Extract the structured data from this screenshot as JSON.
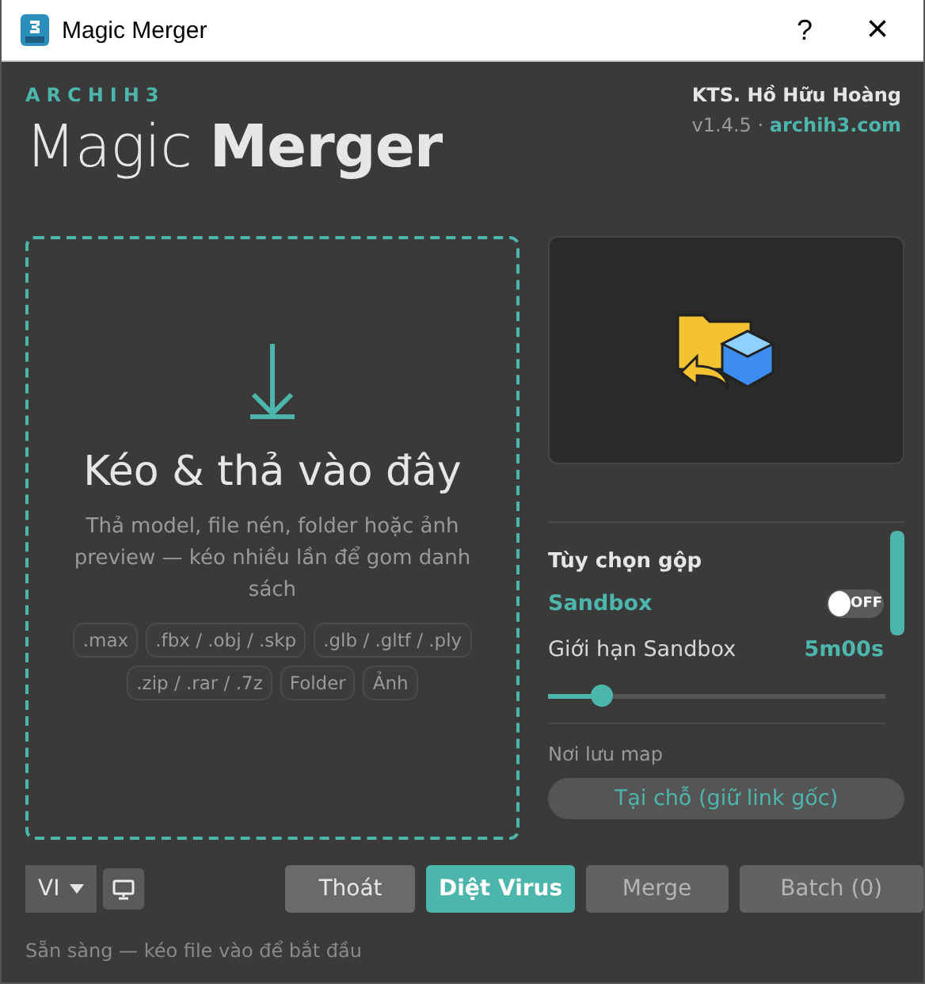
{
  "window": {
    "title": "Magic Merger",
    "help": "?",
    "close": "×"
  },
  "header": {
    "brand": "ARCHIH3",
    "title_light": "Magic",
    "title_bold": "Merger",
    "author": "KTS. Hồ Hữu Hoàng",
    "version": "v1.4.5 ·",
    "site": "archih3.com"
  },
  "drop_zone": {
    "heading": "Kéo & thả vào đây",
    "description": "Thả model, file nén, folder hoặc ảnh preview — kéo nhiều lần để gom danh sách",
    "tags": [
      ".max",
      ".fbx / .obj / .skp",
      ".glb / .gltf / .ply",
      ".zip / .rar / .7z",
      "Folder",
      "Ảnh"
    ]
  },
  "options": {
    "heading": "Tùy chọn gộp",
    "sandbox": {
      "label": "Sandbox",
      "on": false,
      "toggle_text": "OFF"
    },
    "limit": {
      "label": "Giới hạn Sandbox",
      "reading": "5m00s",
      "level": 0.16
    },
    "map_location": {
      "label": "Nơi lưu map",
      "button": "Tại chỗ (giữ link gốc)"
    }
  },
  "footer": {
    "language": "VI",
    "buttons": [
      {
        "label": "Thoát",
        "kind": "plain",
        "disabled": false
      },
      {
        "label": "Diệt Virus",
        "kind": "primary",
        "disabled": false
      },
      {
        "label": "Merge",
        "kind": "plain",
        "disabled": true
      },
      {
        "label": "Batch (0)",
        "kind": "plain",
        "disabled": true
      }
    ]
  },
  "status_bar": "Sẵn sàng — kéo file vào để bắt đầu"
}
